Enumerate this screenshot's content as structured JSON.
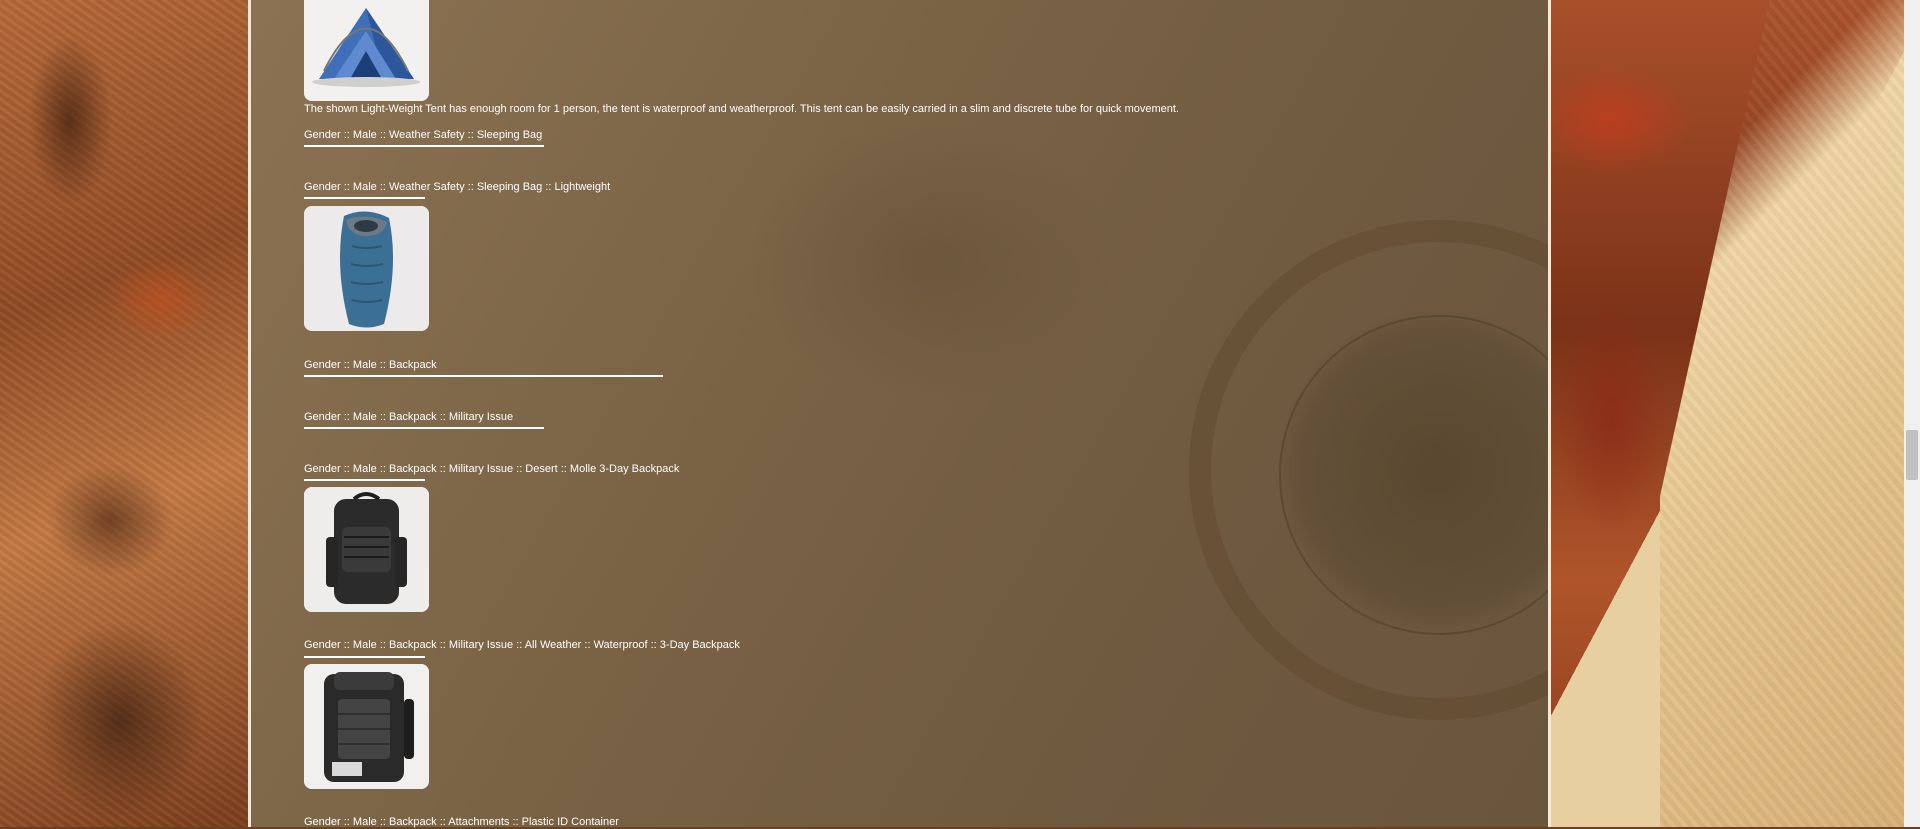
{
  "products": [
    {
      "image_icon": "tent-icon",
      "description": "The shown Light-Weight Tent has enough room for 1 person, the tent is waterproof and weatherproof. This tent can be easily carried in a slim and discrete tube for quick movement."
    },
    {
      "image_icon": "sleeping-bag-icon"
    },
    {
      "image_icon": "backpack-icon"
    },
    {
      "image_icon": "waterproof-backpack-icon"
    }
  ],
  "categories": [
    {
      "label": "Gender :: Male :: Weather Safety :: Sleeping Bag"
    },
    {
      "label": "Gender :: Male :: Weather Safety :: Sleeping Bag :: Lightweight"
    },
    {
      "label": "Gender :: Male :: Backpack"
    },
    {
      "label": "Gender :: Male :: Backpack :: Military Issue"
    },
    {
      "label": "Gender :: Male :: Backpack :: Military Issue :: Desert :: Molle 3-Day Backpack"
    },
    {
      "label": "Gender :: Male :: Backpack :: Military Issue :: All Weather :: Waterproof :: 3-Day Backpack"
    },
    {
      "label": "Gender :: Male :: Backpack :: Attachments :: Plastic ID Container"
    }
  ],
  "colors": {
    "text": "#ffffff",
    "panel": "#7a6245",
    "divider": "#f3e9dc"
  }
}
